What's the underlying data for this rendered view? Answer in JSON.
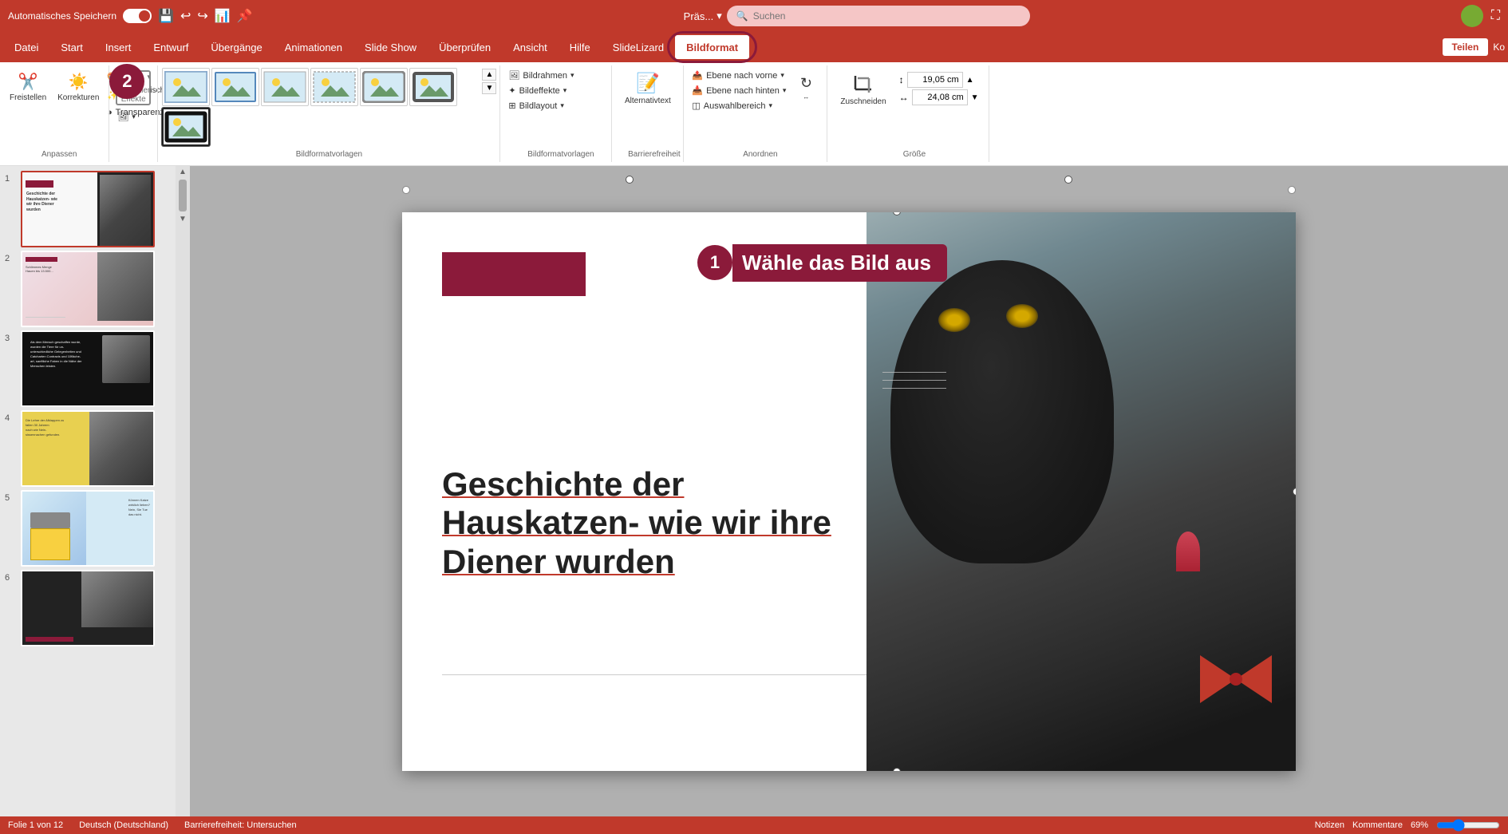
{
  "app": {
    "title": "Präs...",
    "autosave": "Automatisches Speichern",
    "search_placeholder": "Suchen",
    "share": "Teilen",
    "ko": "Ko"
  },
  "menu": {
    "items": [
      {
        "id": "datei",
        "label": "Datei"
      },
      {
        "id": "start",
        "label": "Start"
      },
      {
        "id": "insert",
        "label": "Insert"
      },
      {
        "id": "entwurf",
        "label": "Entwurf"
      },
      {
        "id": "uebergaenge",
        "label": "Übergänge"
      },
      {
        "id": "animationen",
        "label": "Animationen"
      },
      {
        "id": "slideshow",
        "label": "Slide Show"
      },
      {
        "id": "ueberpruefen",
        "label": "Überprüfen"
      },
      {
        "id": "ansicht",
        "label": "Ansicht"
      },
      {
        "id": "hilfe",
        "label": "Hilfe"
      },
      {
        "id": "slidelizard",
        "label": "SlideLizard"
      },
      {
        "id": "bildformat",
        "label": "Bildformat",
        "active": true
      }
    ]
  },
  "ribbon": {
    "groups": {
      "anpassen": {
        "label": "Anpassen",
        "freistellen": "Freistellen",
        "korrekturen": "Korrekturen",
        "farbe": "Farbe",
        "kuenstlerische_effekte": "Künstlerische Effekte",
        "transparenz": "Transparenz"
      },
      "bildformatvorlagen": {
        "label": "Bildformatvorlagen",
        "expand_label": "Bildformatvorlagen"
      },
      "bildrahmen": "Bildrahmen",
      "bildeffekte": "Bildeffekte",
      "bildlayout": "Bildlayout",
      "barrierefreiheit": {
        "label": "Barrierefreiheit",
        "alternativtext": "Alternativtext"
      },
      "anordnen": {
        "label": "Anordnen",
        "ebene_nach_vorne": "Ebene nach vorne",
        "ebene_nach_hinten": "Ebene nach hinten",
        "auswahlbereich": "Auswahlbereich"
      },
      "groesse": {
        "label": "Größe",
        "hoehe": "19,05 cm",
        "breite": "24,08 cm",
        "zuschneiden": "Zuschneiden"
      }
    }
  },
  "slide": {
    "title": "Geschichte der Hauskatzen- wie wir ihre Diener wurden",
    "annotation1_num": "1",
    "annotation1_label": "Wähle das Bild aus",
    "annotation2_num": "2"
  },
  "slides": [
    {
      "num": "1",
      "active": true
    },
    {
      "num": "2"
    },
    {
      "num": "3"
    },
    {
      "num": "4"
    },
    {
      "num": "5"
    },
    {
      "num": "6"
    }
  ],
  "status": {
    "slide_info": "Folie 1 von 12",
    "language": "Deutsch (Deutschland)",
    "accessibility": "Barrierefreiheit: Untersuchen",
    "notes": "Notizen",
    "comments": "Kommentare",
    "zoom": "69%"
  }
}
